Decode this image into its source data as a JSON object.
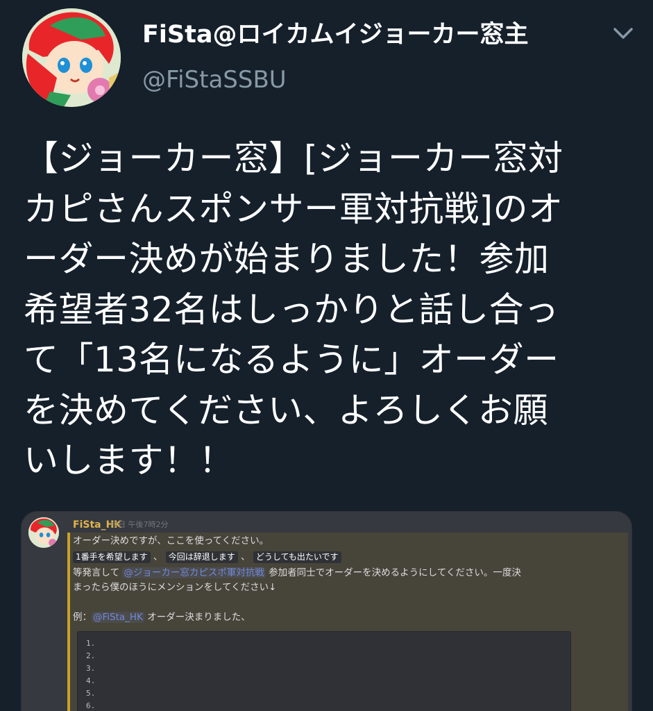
{
  "tweet": {
    "display_name": "FiSta@ロイカムイジョーカー窓主",
    "handle": "@FiStaSSBU",
    "text_lines": [
      "【ジョーカー窓】[ジョーカー窓対",
      "カピさんスポンサー軍対抗戦]のオ",
      "ーダー決めが始まりました！参加",
      "希望者32名はしっかりと話し合っ",
      "て「13名になるように」オーダー",
      "を決めてください、よろしくお願",
      "いします！！"
    ]
  },
  "icons": {
    "menu": "chevron-down-icon",
    "avatar": "avatar"
  },
  "discord": {
    "username": "FiSta_HK",
    "timestamp": "今日 午後7時2分",
    "line1": "オーダー決めですが、ここを使ってください。",
    "code1": "1番手を希望します",
    "sep1": " 、 ",
    "code2": "今回は辞退します",
    "sep2": " 、 ",
    "code3": "どうしても出たいです",
    "line3_pre": "等発言して ",
    "line3_mention": "@ジョーカー窓カピスポ軍対抗戦",
    "line3_post": " 参加者同士でオーダーを決めるようにしてください。一度決",
    "line4": "まったら僕のほうにメンションをしてください↓",
    "example_label": "例：",
    "example_mention": "@FiSta_HK",
    "example_text": " オーダー決まりました、",
    "list": [
      "1.",
      "2.",
      "3.",
      "4.",
      "5.",
      "6."
    ]
  },
  "colors": {
    "background": "#15202b",
    "name": "#ffffff",
    "handle": "#8899a6",
    "discord_user": "#e0b44a",
    "mention": "#7289da"
  }
}
